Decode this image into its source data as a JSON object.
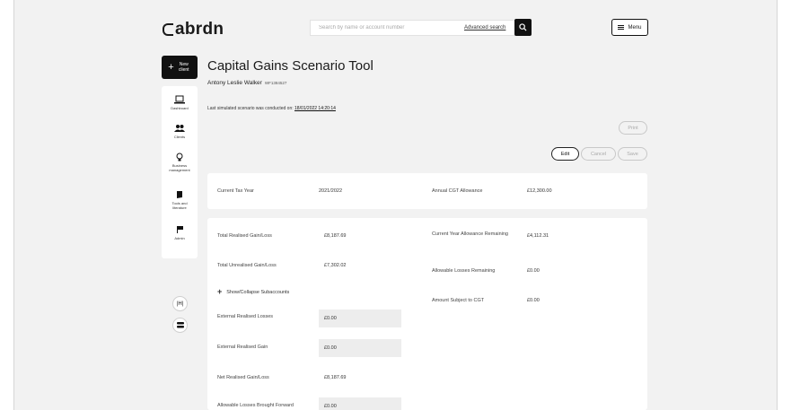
{
  "header": {
    "logo": "abrdn",
    "search_placeholder": "Search by name or account number",
    "advanced_search": "Advanced search",
    "menu_label": "Menu"
  },
  "nav": {
    "new_client": "New\nclient",
    "items": [
      {
        "label": "Dashboard",
        "icon": "laptop-icon"
      },
      {
        "label": "Clients",
        "icon": "people-icon"
      },
      {
        "label": "Business\nmanagement",
        "icon": "lightbulb-icon"
      },
      {
        "label": "Tools and\nliterature",
        "icon": "book-icon"
      },
      {
        "label": "Admin",
        "icon": "flag-icon"
      }
    ],
    "fab_top": "|H|"
  },
  "page": {
    "title": "Capital Gains Scenario Tool",
    "client_name": "Antony Leslie Walker",
    "client_id": "WF1384527",
    "last_sim_prefix": "Last simulated scenario was conducted on:",
    "last_sim_timestamp": "18/01/2022 14:20:14"
  },
  "buttons": {
    "print": "Print",
    "edit": "Edit",
    "cancel": "Cancel",
    "save": "Save"
  },
  "tax_year_card": {
    "current_tax_year_label": "Current Tax Year",
    "current_tax_year_value": "2021/2022",
    "annual_allowance_label": "Annual CGT Allowance",
    "annual_allowance_value": "£12,300.00"
  },
  "details": {
    "total_realised_label": "Total Realised Gain/Loss",
    "total_realised_value": "£8,187.69",
    "total_unrealised_label": "Total Unrealised Gain/Loss",
    "total_unrealised_value": "£7,302.02",
    "toggle_subaccounts": "Show/Collapse Subaccounts",
    "external_losses_label": "External Realised Losses",
    "external_losses_value": "£0.00",
    "external_gain_label": "External Realised Gain",
    "external_gain_value": "£0.00",
    "net_realised_label": "Net Realised Gain/Loss",
    "net_realised_value": "£8,187.69",
    "losses_bf_label": "Allowable Losses Brought Forward",
    "losses_bf_value": "£0.00",
    "cy_allowance_label": "Current Year Allowance Remaining",
    "cy_allowance_value": "£4,112.31",
    "losses_remaining_label": "Allowable Losses Remaining",
    "losses_remaining_value": "£0.00",
    "subject_cgt_label": "Amount Subject to CGT",
    "subject_cgt_value": "£0.00"
  }
}
